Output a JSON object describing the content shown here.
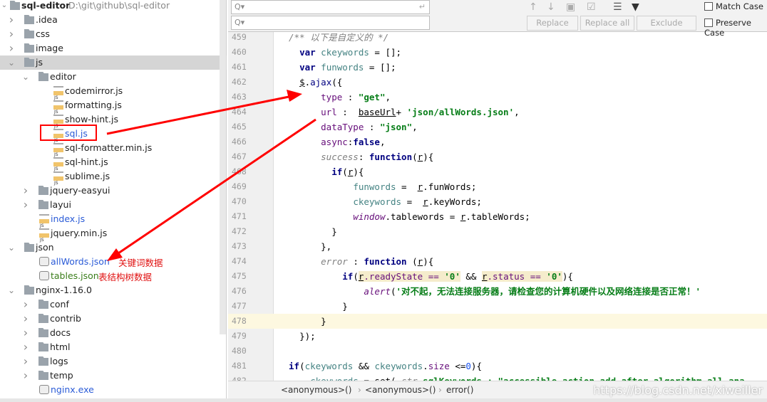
{
  "project": {
    "name": "sql-editor",
    "path": "D:\\git\\github\\sql-editor"
  },
  "tree": [
    {
      "label": ".idea",
      "level": 1,
      "type": "folder",
      "arrow": "right"
    },
    {
      "label": "css",
      "level": 1,
      "type": "folder",
      "arrow": "right"
    },
    {
      "label": "image",
      "level": 1,
      "type": "folder",
      "arrow": "right"
    },
    {
      "label": "js",
      "level": 1,
      "type": "folder",
      "arrow": "down",
      "selected": true
    },
    {
      "label": "editor",
      "level": 2,
      "type": "folder",
      "arrow": "down"
    },
    {
      "label": "codemirror.js",
      "level": 3,
      "type": "js"
    },
    {
      "label": "formatting.js",
      "level": 3,
      "type": "js"
    },
    {
      "label": "show-hint.js",
      "level": 3,
      "type": "js"
    },
    {
      "label": "sql.js",
      "level": 3,
      "type": "js",
      "color": "blue"
    },
    {
      "label": "sql-formatter.min.js",
      "level": 3,
      "type": "min"
    },
    {
      "label": "sql-hint.js",
      "level": 3,
      "type": "js"
    },
    {
      "label": "sublime.js",
      "level": 3,
      "type": "js"
    },
    {
      "label": "jquery-easyui",
      "level": 2,
      "type": "folder",
      "arrow": "right"
    },
    {
      "label": "layui",
      "level": 2,
      "type": "folder",
      "arrow": "right"
    },
    {
      "label": "index.js",
      "level": 2,
      "type": "js",
      "color": "blue"
    },
    {
      "label": "jquery.min.js",
      "level": 2,
      "type": "min"
    },
    {
      "label": "json",
      "level": 1,
      "type": "folder",
      "arrow": "down"
    },
    {
      "label": "allWords.json",
      "level": 2,
      "type": "json",
      "color": "blue"
    },
    {
      "label": "tables.json",
      "level": 2,
      "type": "json",
      "color": "green"
    },
    {
      "label": "nginx-1.16.0",
      "level": 1,
      "type": "folder",
      "arrow": "down"
    },
    {
      "label": "conf",
      "level": 2,
      "type": "folder",
      "arrow": "right"
    },
    {
      "label": "contrib",
      "level": 2,
      "type": "folder",
      "arrow": "right"
    },
    {
      "label": "docs",
      "level": 2,
      "type": "folder",
      "arrow": "right"
    },
    {
      "label": "html",
      "level": 2,
      "type": "folder",
      "arrow": "right"
    },
    {
      "label": "logs",
      "level": 2,
      "type": "folder",
      "arrow": "right"
    },
    {
      "label": "temp",
      "level": 2,
      "type": "folder",
      "arrow": "right"
    },
    {
      "label": "nginx.exe",
      "level": 2,
      "type": "exe",
      "color": "blue"
    }
  ],
  "annotations": {
    "allWords": "关键词数据",
    "tables": "表结构树数据",
    "color": "#ff0000"
  },
  "find": {
    "search_placeholder": "Q▾",
    "replace_placeholder": "Q▾",
    "replace": "Replace",
    "replace_all": "Replace all",
    "exclude": "Exclude",
    "match_case": "Match Case",
    "preserve_case": "Preserve Case"
  },
  "code": [
    {
      "n": "459",
      "i": 0,
      "t": [
        [
          "/** 以下是自定义的 */",
          "cm"
        ]
      ]
    },
    {
      "n": "460",
      "i": 2,
      "t": [
        [
          "var",
          "kw"
        ],
        [
          " ",
          "pl"
        ],
        [
          "ckeywords",
          "var"
        ],
        [
          " = [];",
          "pl"
        ]
      ]
    },
    {
      "n": "461",
      "i": 2,
      "t": [
        [
          "var",
          "kw"
        ],
        [
          " ",
          "pl"
        ],
        [
          "funwords",
          "var"
        ],
        [
          " = [];",
          "pl"
        ]
      ]
    },
    {
      "n": "462",
      "i": 2,
      "t": [
        [
          "$",
          "pl ul"
        ],
        [
          ".",
          "pl"
        ],
        [
          "ajax",
          "fn"
        ],
        [
          "({",
          "pl"
        ]
      ]
    },
    {
      "n": "463",
      "i": 6,
      "t": [
        [
          "type",
          "prop"
        ],
        [
          " : ",
          "pl"
        ],
        [
          "\"get\"",
          "str"
        ],
        [
          ",",
          "pl"
        ]
      ]
    },
    {
      "n": "464",
      "i": 6,
      "t": [
        [
          "url",
          "prop"
        ],
        [
          " :  ",
          "pl"
        ],
        [
          "baseUrl",
          "pl ul"
        ],
        [
          "+ ",
          "pl"
        ],
        [
          "'json/allWords.json'",
          "str"
        ],
        [
          ",",
          "pl"
        ]
      ]
    },
    {
      "n": "465",
      "i": 6,
      "t": [
        [
          "dataType",
          "prop"
        ],
        [
          " : ",
          "pl"
        ],
        [
          "\"json\"",
          "str"
        ],
        [
          ",",
          "pl"
        ]
      ]
    },
    {
      "n": "466",
      "i": 6,
      "t": [
        [
          "async",
          "prop"
        ],
        [
          ":",
          "pl"
        ],
        [
          "false",
          "kw"
        ],
        [
          ",",
          "pl"
        ]
      ]
    },
    {
      "n": "467",
      "i": 6,
      "t": [
        [
          "success",
          "cm"
        ],
        [
          ": ",
          "pl"
        ],
        [
          "function",
          "kw"
        ],
        [
          "(",
          "pl"
        ],
        [
          "r",
          "pl ul"
        ],
        [
          "){",
          "pl"
        ]
      ]
    },
    {
      "n": "468",
      "i": 8,
      "t": [
        [
          "if",
          "kw"
        ],
        [
          "(",
          "pl"
        ],
        [
          "r",
          "pl ul"
        ],
        [
          "){",
          "pl"
        ]
      ]
    },
    {
      "n": "469",
      "i": 12,
      "t": [
        [
          "funwords",
          "var"
        ],
        [
          " =  ",
          "pl"
        ],
        [
          "r",
          "pl ul"
        ],
        [
          ".funWords;",
          "pl"
        ]
      ]
    },
    {
      "n": "470",
      "i": 12,
      "t": [
        [
          "ckeywords",
          "var"
        ],
        [
          " =  ",
          "pl"
        ],
        [
          "r",
          "pl ul"
        ],
        [
          ".keyWords;",
          "pl"
        ]
      ]
    },
    {
      "n": "471",
      "i": 12,
      "t": [
        [
          "window",
          "it"
        ],
        [
          ".tablewords = ",
          "pl"
        ],
        [
          "r",
          "pl ul"
        ],
        [
          ".tableWords;",
          "pl"
        ]
      ]
    },
    {
      "n": "472",
      "i": 8,
      "t": [
        [
          "}",
          "pl"
        ]
      ]
    },
    {
      "n": "473",
      "i": 6,
      "t": [
        [
          "},",
          "pl"
        ]
      ]
    },
    {
      "n": "474",
      "i": 6,
      "t": [
        [
          "error",
          "cm"
        ],
        [
          " : ",
          "pl"
        ],
        [
          "function",
          "kw"
        ],
        [
          " (",
          "pl"
        ],
        [
          "r",
          "pl ul"
        ],
        [
          "){",
          "pl"
        ]
      ]
    },
    {
      "n": "475",
      "i": 10,
      "t": [
        [
          "if",
          "kw"
        ],
        [
          "(",
          "pl"
        ],
        [
          "r",
          "pl ul hl"
        ],
        [
          ".readyState == ",
          "prop hl"
        ],
        [
          "'0'",
          "str hl"
        ],
        [
          " && ",
          "pl"
        ],
        [
          "r",
          "pl ul hl"
        ],
        [
          ".status == ",
          "prop hl"
        ],
        [
          "'0'",
          "str hl"
        ],
        [
          "){",
          "pl"
        ]
      ]
    },
    {
      "n": "476",
      "i": 14,
      "t": [
        [
          "alert",
          "it"
        ],
        [
          "(",
          "pl"
        ],
        [
          "'对不起，无法连接服务器，请检查您的计算机硬件以及网络连接是否正常！'",
          "str"
        ]
      ]
    },
    {
      "n": "477",
      "i": 10,
      "t": [
        [
          "}",
          "pl"
        ]
      ]
    },
    {
      "n": "478",
      "i": 6,
      "t": [
        [
          "}",
          "pl"
        ]
      ],
      "current": true
    },
    {
      "n": "479",
      "i": 2,
      "t": [
        [
          "});",
          "pl"
        ]
      ]
    },
    {
      "n": "480",
      "i": 0,
      "t": []
    },
    {
      "n": "481",
      "i": 0,
      "t": [
        [
          "if",
          "kw"
        ],
        [
          "(",
          "pl"
        ],
        [
          "ckeywords",
          "var"
        ],
        [
          " && ",
          "pl"
        ],
        [
          "ckeywords",
          "var"
        ],
        [
          ".",
          "pl"
        ],
        [
          "size",
          "prop"
        ],
        [
          " <=",
          "pl"
        ],
        [
          "0",
          "num2"
        ],
        [
          "){",
          "pl"
        ]
      ]
    },
    {
      "n": "482",
      "i": 4,
      "t": [
        [
          "ckeywords",
          "var"
        ],
        [
          " = set( ",
          "pl"
        ],
        [
          "str",
          "cm"
        ],
        [
          " sqlKeywords : \"accessible action add after algorithm all ana",
          "str"
        ]
      ]
    }
  ],
  "breadcrumbs": [
    "<anonymous>()",
    "<anonymous>()",
    "error()"
  ],
  "watermark": "https://blog.csdn.net/xiweiller"
}
